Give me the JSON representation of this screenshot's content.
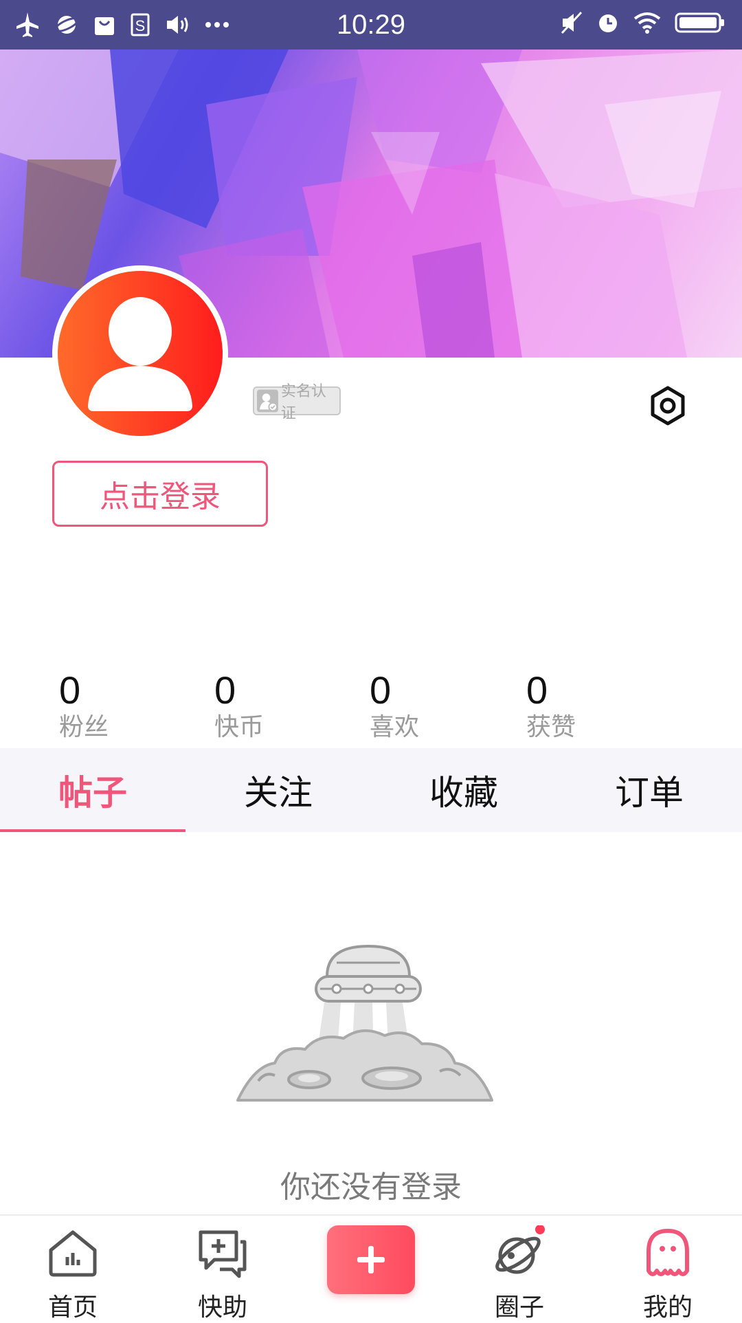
{
  "status_bar": {
    "time": "10:29"
  },
  "profile": {
    "verify_label": "实名认证",
    "login_button": "点击登录"
  },
  "stats": [
    {
      "value": "0",
      "label": "粉丝"
    },
    {
      "value": "0",
      "label": "快币"
    },
    {
      "value": "0",
      "label": "喜欢"
    },
    {
      "value": "0",
      "label": "获赞"
    }
  ],
  "tabs": [
    {
      "label": "帖子",
      "active": true
    },
    {
      "label": "关注",
      "active": false
    },
    {
      "label": "收藏",
      "active": false
    },
    {
      "label": "订单",
      "active": false
    }
  ],
  "empty_state": {
    "message": "你还没有登录"
  },
  "bottom_nav": [
    {
      "label": "首页",
      "icon": "home-icon"
    },
    {
      "label": "快助",
      "icon": "chat-plus-icon"
    },
    {
      "label": "",
      "icon": "plus-icon"
    },
    {
      "label": "圈子",
      "icon": "planet-icon"
    },
    {
      "label": "我的",
      "icon": "ghost-face-icon"
    }
  ],
  "colors": {
    "accent": "#f0557a",
    "status_bar": "#4b4a8c",
    "avatar_gradient_start": "#ff6a2a",
    "avatar_gradient_end": "#ff1d1d"
  }
}
